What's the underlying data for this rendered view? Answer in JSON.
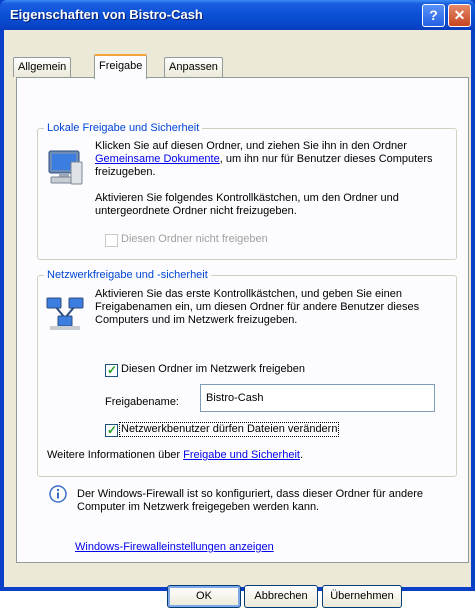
{
  "window": {
    "title": "Eigenschaften von Bistro-Cash"
  },
  "tabs": [
    "Allgemein",
    "Freigabe",
    "Anpassen"
  ],
  "local": {
    "legend": "Lokale Freigabe und Sicherheit",
    "p1_pre": "Klicken Sie auf diesen Ordner, und ziehen Sie ihn in den Ordner ",
    "p1_link": "Gemeinsame Dokumente",
    "p1_post": ", um ihn nur für Benutzer dieses Computers freizugeben.",
    "p2": "Aktivieren Sie folgendes Kontrollkästchen, um den Ordner und untergeordnete Ordner nicht freizugeben.",
    "checkbox": "Diesen Ordner nicht freigeben"
  },
  "network": {
    "legend": "Netzwerkfreigabe und -sicherheit",
    "p1": "Aktivieren Sie das erste Kontrollkästchen, und geben Sie einen Freigabenamen ein, um diesen Ordner für andere Benutzer dieses Computers und im Netzwerk freizugeben.",
    "share_checkbox": "Diesen Ordner im Netzwerk freigeben",
    "share_name_label": "Freigabename:",
    "share_name_value": "Bistro-Cash",
    "write_checkbox": "Netzwerkbenutzer dürfen Dateien verändern",
    "more_pre": "Weitere Informationen über ",
    "more_link": "Freigabe und Sicherheit",
    "more_post": "."
  },
  "firewall": {
    "info": "Der Windows-Firewall ist so konfiguriert, dass dieser Ordner für andere Computer im Netzwerk freigegeben werden kann.",
    "link": "Windows-Firewalleinstellungen anzeigen"
  },
  "buttons": {
    "ok": "OK",
    "cancel": "Abbrechen",
    "apply": "Übernehmen"
  }
}
